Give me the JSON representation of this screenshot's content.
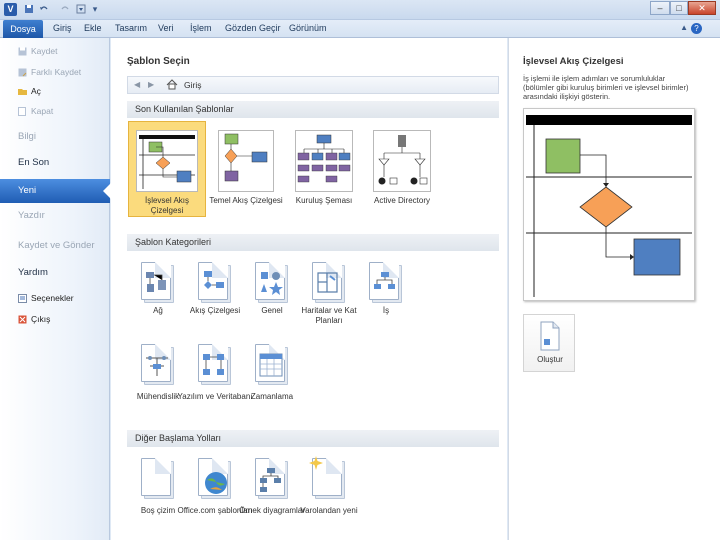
{
  "title_bar": {
    "app_icon_letter": "V",
    "qat": [
      "save-icon",
      "undo-icon",
      "redo-icon",
      "customize-icon"
    ],
    "window_buttons": [
      "minimize-icon",
      "maximize-icon",
      "close-icon"
    ],
    "window_glyphs": {
      "min": "–",
      "max": "□",
      "close": "✕"
    }
  },
  "ribbon": {
    "tabs": [
      "Dosya",
      "Giriş",
      "Ekle",
      "Tasarım",
      "Veri",
      "İşlem",
      "Gözden Geçir",
      "Görünüm"
    ],
    "help_glyph": "?",
    "minimize_glyph": "▲"
  },
  "backstage_nav": {
    "commands": [
      {
        "label": "Kaydet",
        "icon": "save-icon",
        "enabled": false
      },
      {
        "label": "Farklı Kaydet",
        "icon": "save-as-icon",
        "enabled": false
      },
      {
        "label": "Aç",
        "icon": "open-folder-icon",
        "enabled": true
      },
      {
        "label": "Kapat",
        "icon": "close-file-icon",
        "enabled": false
      }
    ],
    "sections": [
      {
        "label": "Bilgi",
        "enabled": false
      },
      {
        "label": "En Son",
        "enabled": true
      },
      {
        "label": "Yeni",
        "enabled": true,
        "selected": true
      },
      {
        "label": "Yazdır",
        "enabled": false
      },
      {
        "label": "Kaydet ve Gönder",
        "enabled": false
      },
      {
        "label": "Yardım",
        "enabled": true
      }
    ],
    "bottom": [
      {
        "label": "Seçenekler",
        "icon": "options-icon"
      },
      {
        "label": "Çıkış",
        "icon": "exit-icon"
      }
    ]
  },
  "middle": {
    "title": "Şablon Seçin",
    "nav": {
      "back": "◀",
      "forward": "▶",
      "home_label": "Giriş"
    },
    "recent_header": "Son Kullanılan Şablonlar",
    "recent": [
      {
        "label": "İşlevsel Akış Çizelgesi",
        "selected": true
      },
      {
        "label": "Temel Akış Çizelgesi",
        "selected": false
      },
      {
        "label": "Kuruluş Şeması",
        "selected": false
      },
      {
        "label": "Active Directory",
        "selected": false
      }
    ],
    "categories_header": "Şablon Kategorileri",
    "categories": [
      {
        "label": "Ağ"
      },
      {
        "label": "Akış Çizelgesi"
      },
      {
        "label": "Genel"
      },
      {
        "label": "Haritalar ve Kat Planları"
      },
      {
        "label": "İş"
      },
      {
        "label": "Mühendislik"
      },
      {
        "label": "Yazılım ve Veritabanı"
      },
      {
        "label": "Zamanlama"
      }
    ],
    "other_header": "Diğer Başlama Yolları",
    "other": [
      {
        "label": "Boş çizim"
      },
      {
        "label": "Office.com şablonları"
      },
      {
        "label": "Örnek diyagramlar"
      },
      {
        "label": "Varolandan yeni"
      }
    ]
  },
  "preview": {
    "title": "İşlevsel Akış Çizelgesi",
    "description": "İş işlemi ile işlem adımları ve sorumluluklar (bölümler gibi kuruluş birimleri ve işlevsel birimler) arasındaki ilişkiyi gösterin.",
    "create_label": "Oluştur"
  },
  "colors": {
    "selected_tile": "#fbdb7d",
    "nav_selected": "#1f5db3",
    "green_shape": "#8fbf63",
    "orange_shape": "#f7a057",
    "blue_shape": "#4f7fc1",
    "purple_shape": "#8064a2"
  }
}
